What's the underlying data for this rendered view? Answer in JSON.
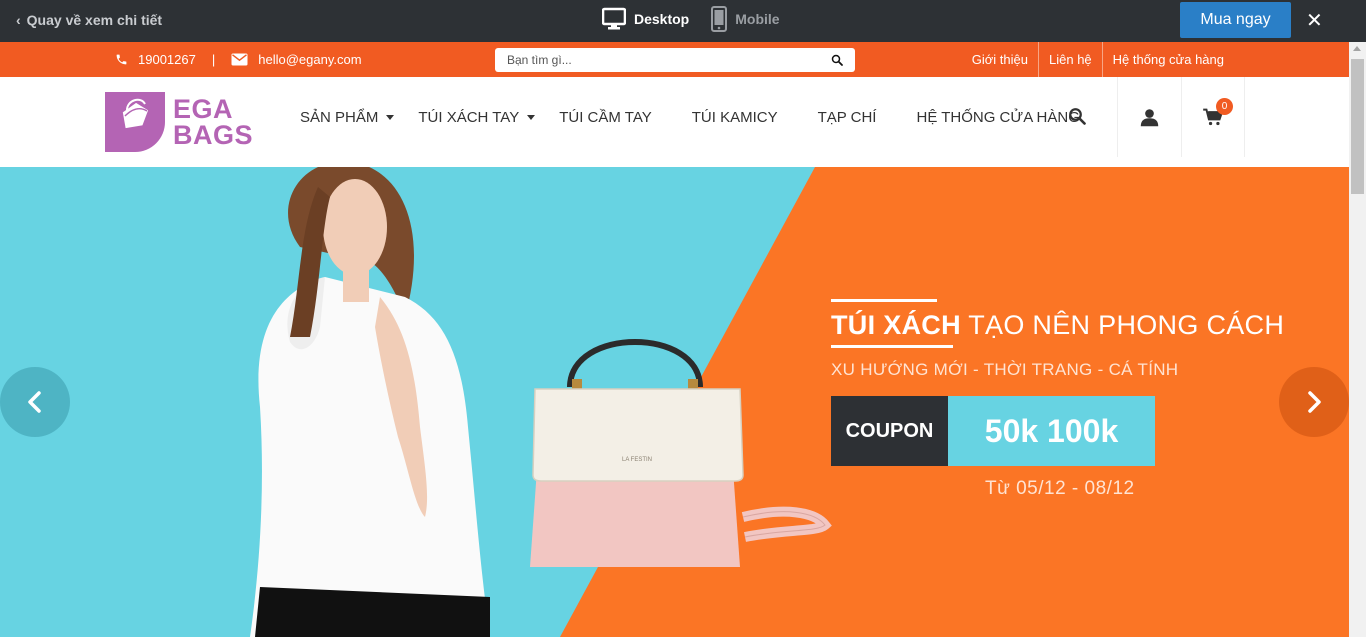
{
  "preview_bar": {
    "back_label": "Quay về xem chi tiết",
    "desktop_label": "Desktop",
    "mobile_label": "Mobile",
    "buy_label": "Mua ngay",
    "close_label": "✕"
  },
  "topbar": {
    "phone": "19001267",
    "separator": "|",
    "email": "hello@egany.com",
    "search_placeholder": "Bạn tìm gì...",
    "links": [
      "Giới thiệu",
      "Liên hệ",
      "Hệ thống cửa hàng"
    ]
  },
  "header": {
    "logo_line1": "EGA",
    "logo_line2": "BAGS",
    "nav": [
      "SẢN PHẨM",
      "TÚI XÁCH TAY",
      "TÚI CẦM TAY",
      "TÚI KAMICY",
      "TẠP CHÍ",
      "HỆ THỐNG CỬA HÀNG"
    ],
    "cart_count": "0"
  },
  "banner": {
    "title_bold": "TÚI XÁCH",
    "title_rest": " TẠO NÊN PHONG CÁCH",
    "subtitle": "XU HƯỚNG MỚI - THỜI TRANG - CÁ TÍNH",
    "coupon_label": "COUPON",
    "coupon_value": "50k 100k",
    "date_range": "Từ 05/12  -  08/12",
    "bag_brand": "LA FESTIN"
  },
  "colors": {
    "accent_orange": "#f15b22",
    "banner_cyan": "#67d3e2",
    "logo_purple": "#b464b4",
    "buy_blue": "#2a7fc7"
  }
}
